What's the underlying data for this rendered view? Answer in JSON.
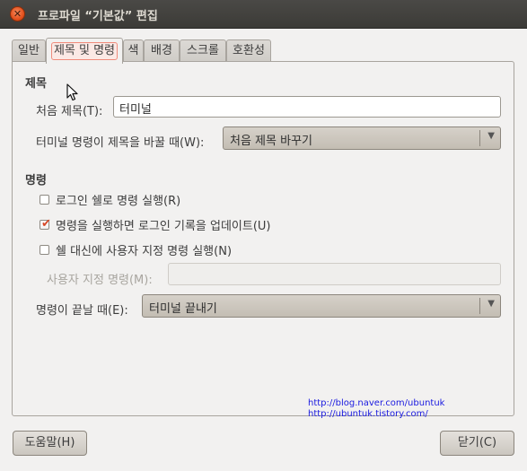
{
  "window": {
    "title": "프로파일 “기본값” 편집"
  },
  "tabs": [
    {
      "label": "일반"
    },
    {
      "label": "제목 및 명령"
    },
    {
      "label": "색"
    },
    {
      "label": "배경"
    },
    {
      "label": "스크롤"
    },
    {
      "label": "호환성"
    }
  ],
  "title_section": {
    "heading": "제목",
    "initial_title_label": "처음 제목(T):",
    "initial_title_value": "터미널",
    "dynamic_title_label": "터미널 명령이 제목을 바꿀 때(W):",
    "dynamic_title_value": "처음 제목 바꾸기"
  },
  "command_section": {
    "heading": "명령",
    "login_shell_label": "로그인 쉘로 명령 실행(R)",
    "login_shell_checked": false,
    "update_records_label": "명령을 실행하면 로그인 기록을 업데이트(U)",
    "update_records_checked": true,
    "custom_command_label": "쉘 대신에 사용자 지정 명령 실행(N)",
    "custom_command_checked": false,
    "custom_command_field_label": "사용자 지정 명령(M):",
    "custom_command_value": "",
    "exit_action_label": "명령이 끝날 때(E):",
    "exit_action_value": "터미널 끝내기"
  },
  "credits": {
    "line1": "http://blog.naver.com/ubuntuk",
    "line2": "http://ubuntuk.tistory.com/"
  },
  "buttons": {
    "help": "도움말(H)",
    "close": "닫기(C)"
  },
  "colors": {
    "titlebar": "#3c3b37",
    "close_button": "#e3511e",
    "check_mark": "#d64a2a",
    "focus_ring": "#f08b7b"
  }
}
